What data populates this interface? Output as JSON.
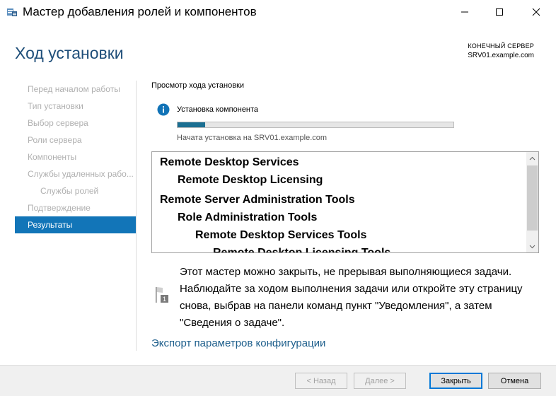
{
  "window": {
    "title": "Мастер добавления ролей и компонентов",
    "controls": [
      "minimize-icon",
      "maximize-icon",
      "close-icon"
    ]
  },
  "header": {
    "page_title": "Ход установки",
    "destination_label": "КОНЕЧНЫЙ СЕРВЕР",
    "destination_server": "SRV01.example.com"
  },
  "nav": {
    "items": [
      {
        "label": "Перед началом работы",
        "indent": 0,
        "active": false
      },
      {
        "label": "Тип установки",
        "indent": 0,
        "active": false
      },
      {
        "label": "Выбор сервера",
        "indent": 0,
        "active": false
      },
      {
        "label": "Роли сервера",
        "indent": 0,
        "active": false
      },
      {
        "label": "Компоненты",
        "indent": 0,
        "active": false
      },
      {
        "label": "Службы удаленных рабо...",
        "indent": 0,
        "active": false
      },
      {
        "label": "Службы ролей",
        "indent": 1,
        "active": false
      },
      {
        "label": "Подтверждение",
        "indent": 0,
        "active": false
      },
      {
        "label": "Результаты",
        "indent": 0,
        "active": true
      }
    ]
  },
  "content": {
    "section_title": "Просмотр хода установки",
    "status_text": "Установка компонента",
    "progress": 0.1,
    "progress_note": "Начата установка на SRV01.example.com",
    "features": [
      {
        "label": "Remote Desktop Services",
        "level": 0
      },
      {
        "label": "Remote Desktop Licensing",
        "level": 1
      },
      {
        "label": "Remote Server Administration Tools",
        "level": 0
      },
      {
        "label": "Role Administration Tools",
        "level": 1
      },
      {
        "label": "Remote Desktop Services Tools",
        "level": 2
      },
      {
        "label": "Remote Desktop Licensing Tools",
        "level": 3
      }
    ],
    "notice": "Этот мастер можно закрыть, не прерывая выполняющиеся задачи. Наблюдайте за ходом выполнения задачи или откройте эту страницу снова, выбрав на панели команд пункт \"Уведомления\", а затем \"Сведения о задаче\".",
    "notice_badge": "1",
    "export_link": "Экспорт параметров конфигурации"
  },
  "footer": {
    "back_label": "< Назад",
    "next_label": "Далее >",
    "close_label": "Закрыть",
    "cancel_label": "Отмена"
  },
  "colors": {
    "accent": "#1275b8",
    "title": "#1e4e79",
    "progress": "#1b6f92",
    "link": "#1e5f8c"
  }
}
